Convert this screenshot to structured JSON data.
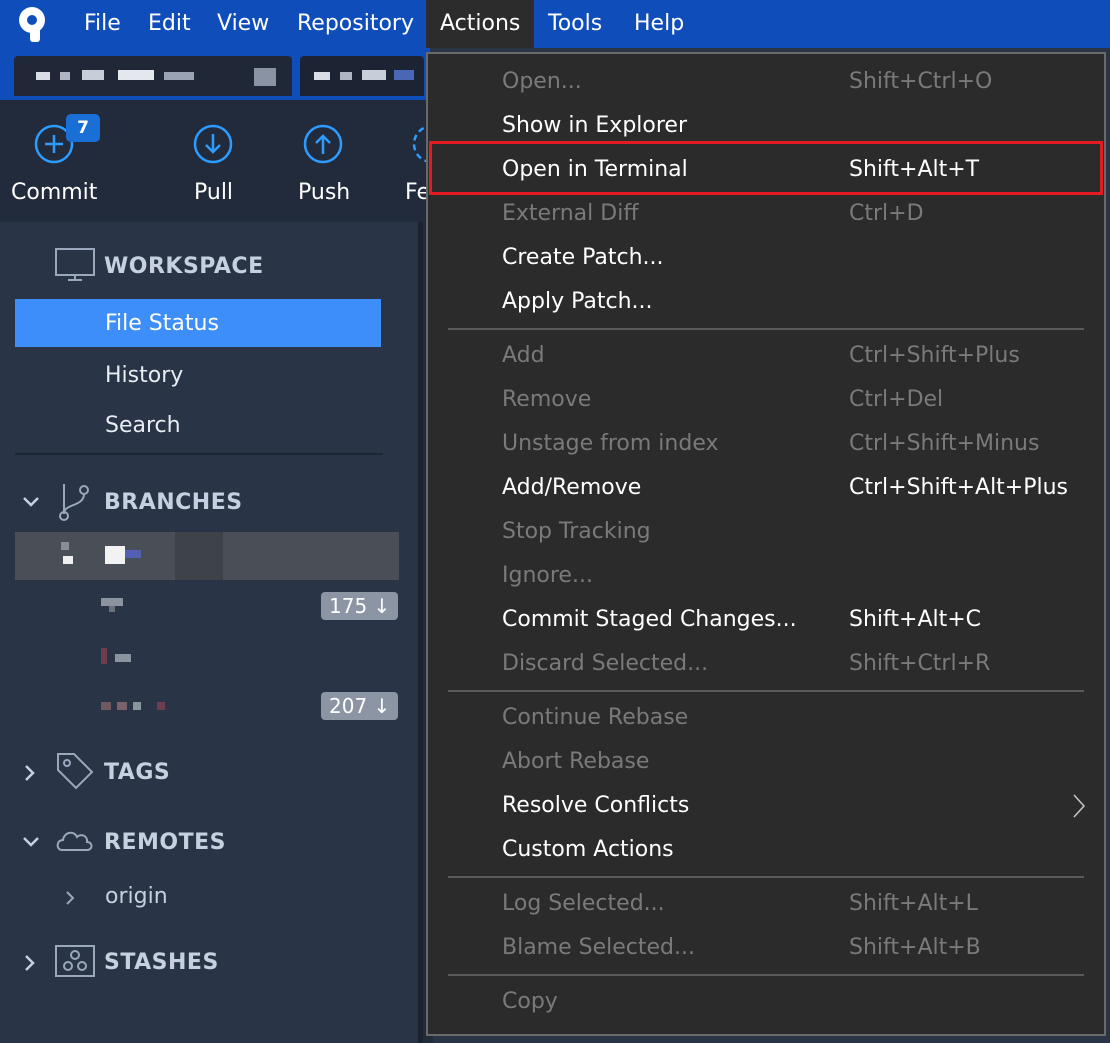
{
  "menubar": {
    "items": [
      "File",
      "Edit",
      "View",
      "Repository",
      "Actions",
      "Tools",
      "Help"
    ],
    "active": "Actions",
    "color": "#0f4dba"
  },
  "toolbar": {
    "commit_label": "Commit",
    "commit_badge": "7",
    "pull_label": "Pull",
    "push_label": "Push",
    "fetch_label_partial": "Fe",
    "icon_color": "#2d9cff"
  },
  "sidebar": {
    "workspace": {
      "title": "WORKSPACE",
      "items": [
        "File Status",
        "History",
        "Search"
      ],
      "selected": "File Status",
      "selected_color": "#3d8ef8"
    },
    "branches": {
      "title": "BRANCHES",
      "counts": [
        "175 ↓",
        "207 ↓"
      ]
    },
    "tags": {
      "title": "TAGS"
    },
    "remotes": {
      "title": "REMOTES",
      "items": [
        "origin"
      ]
    },
    "stashes": {
      "title": "STASHES"
    }
  },
  "actions_menu": {
    "groups": [
      [
        {
          "label": "Open...",
          "shortcut": "Shift+Ctrl+O",
          "enabled": false
        },
        {
          "label": "Show in Explorer",
          "shortcut": "",
          "enabled": true
        },
        {
          "label": "Open in Terminal",
          "shortcut": "Shift+Alt+T",
          "enabled": true,
          "highlighted": true
        },
        {
          "label": "External Diff",
          "shortcut": "Ctrl+D",
          "enabled": false
        },
        {
          "label": "Create Patch...",
          "shortcut": "",
          "enabled": true
        },
        {
          "label": "Apply Patch...",
          "shortcut": "",
          "enabled": true
        }
      ],
      [
        {
          "label": "Add",
          "shortcut": "Ctrl+Shift+Plus",
          "enabled": false
        },
        {
          "label": "Remove",
          "shortcut": "Ctrl+Del",
          "enabled": false
        },
        {
          "label": "Unstage from index",
          "shortcut": "Ctrl+Shift+Minus",
          "enabled": false
        },
        {
          "label": "Add/Remove",
          "shortcut": "Ctrl+Shift+Alt+Plus",
          "enabled": true
        },
        {
          "label": "Stop Tracking",
          "shortcut": "",
          "enabled": false
        },
        {
          "label": "Ignore...",
          "shortcut": "",
          "enabled": false
        },
        {
          "label": "Commit Staged Changes...",
          "shortcut": "Shift+Alt+C",
          "enabled": true
        },
        {
          "label": "Discard Selected...",
          "shortcut": "Shift+Ctrl+R",
          "enabled": false
        }
      ],
      [
        {
          "label": "Continue Rebase",
          "shortcut": "",
          "enabled": false
        },
        {
          "label": "Abort Rebase",
          "shortcut": "",
          "enabled": false
        },
        {
          "label": "Resolve Conflicts",
          "shortcut": "",
          "enabled": true,
          "submenu": true
        },
        {
          "label": "Custom Actions",
          "shortcut": "",
          "enabled": true
        }
      ],
      [
        {
          "label": "Log Selected...",
          "shortcut": "Shift+Alt+L",
          "enabled": false
        },
        {
          "label": "Blame Selected...",
          "shortcut": "Shift+Alt+B",
          "enabled": false
        }
      ],
      [
        {
          "label": "Copy",
          "shortcut": "",
          "enabled": false
        }
      ]
    ],
    "highlight_color": "#e31b23"
  }
}
